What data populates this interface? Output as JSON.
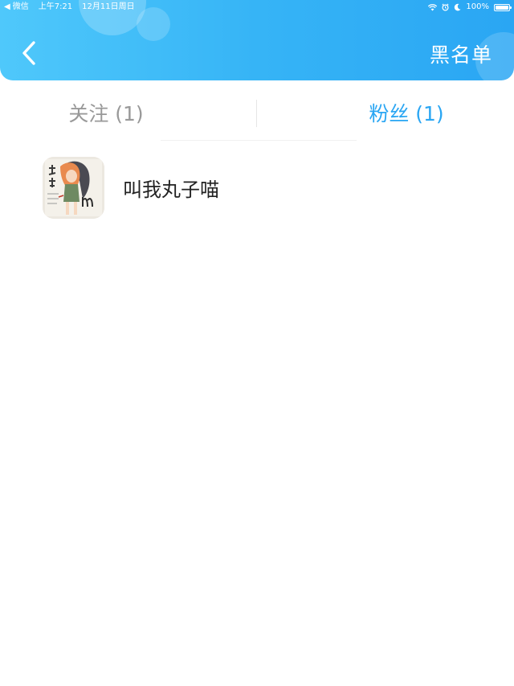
{
  "status_bar": {
    "back_app": "微信",
    "time": "上午7:21",
    "date": "12月11日周日",
    "battery": "100%",
    "battery_level": 1.0
  },
  "header": {
    "back_icon": "chevron-left-icon",
    "blacklist_label": "黑名单"
  },
  "tabs": [
    {
      "label": "关注 (1)",
      "active": false
    },
    {
      "label": "粉丝 (1)",
      "active": true
    }
  ],
  "fans_list": [
    {
      "name": "叫我丸子喵",
      "avatar": "cartoon-girl-drawing"
    }
  ],
  "colors": {
    "header_gradient_start": "#4fc8fb",
    "header_gradient_end": "#2aa6f3",
    "active_tab": "#2aa6f3",
    "inactive_tab": "#999999",
    "text_primary": "#222222"
  }
}
